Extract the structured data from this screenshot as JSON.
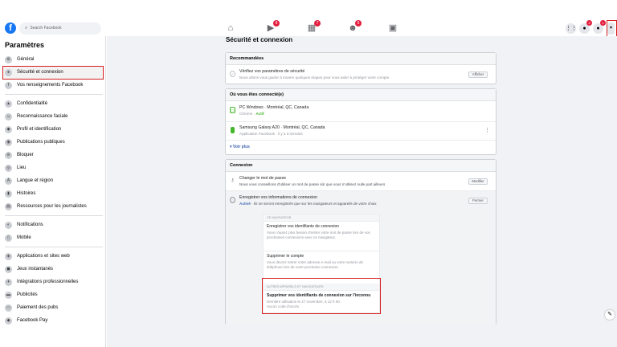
{
  "topbar": {
    "logo": "f",
    "search_placeholder": "Search Facebook",
    "nav": [
      {
        "name": "home",
        "glyph": "⌂",
        "badge": ""
      },
      {
        "name": "watch",
        "glyph": "▶",
        "badge": "9"
      },
      {
        "name": "marketplace",
        "glyph": "▦",
        "badge": "7"
      },
      {
        "name": "groups",
        "glyph": "☻",
        "badge": "5"
      },
      {
        "name": "gaming",
        "glyph": "▣",
        "badge": ""
      }
    ],
    "menu_glyph": "⋮⋮",
    "messenger_glyph": "●",
    "messenger_badge": "3",
    "notif_glyph": "●",
    "notif_badge": "1",
    "account_glyph": "▾"
  },
  "sidebar": {
    "title": "Paramètres",
    "items": [
      {
        "label": "Général",
        "icon": "gear-icon",
        "glyph": "⚙"
      },
      {
        "label": "Sécurité et connexion",
        "icon": "shield-icon",
        "glyph": "●"
      },
      {
        "label": "Vos renseignements Facebook",
        "icon": "facebook-icon",
        "glyph": "f"
      },
      {
        "label": "Confidentialité",
        "icon": "lock-icon",
        "glyph": "▲"
      },
      {
        "label": "Reconnaissance faciale",
        "icon": "face-icon",
        "glyph": "☺"
      },
      {
        "label": "Profil et identification",
        "icon": "tag-icon",
        "glyph": "◆"
      },
      {
        "label": "Publications publiques",
        "icon": "globe-icon",
        "glyph": "◉"
      },
      {
        "label": "Bloquer",
        "icon": "block-icon",
        "glyph": "⊘"
      },
      {
        "label": "Lieu",
        "icon": "location-icon",
        "glyph": "◎"
      },
      {
        "label": "Langue et région",
        "icon": "language-icon",
        "glyph": "A"
      },
      {
        "label": "Histoires",
        "icon": "book-icon",
        "glyph": "▮"
      },
      {
        "label": "Ressources pour les journalistes",
        "icon": "journalist-icon",
        "glyph": "▤"
      },
      {
        "label": "Notifications",
        "icon": "globe-bell-icon",
        "glyph": "◐"
      },
      {
        "label": "Mobile",
        "icon": "mobile-icon",
        "glyph": "▯"
      },
      {
        "label": "Applications et sites web",
        "icon": "apps-icon",
        "glyph": "◈"
      },
      {
        "label": "Jeux instantanés",
        "icon": "games-icon",
        "glyph": "◼"
      },
      {
        "label": "Intégrations professionnelles",
        "icon": "integrations-icon",
        "glyph": "✈"
      },
      {
        "label": "Publicités",
        "icon": "ads-icon",
        "glyph": "▬"
      },
      {
        "label": "Paiement des pubs",
        "icon": "payment-icon",
        "glyph": "▭"
      },
      {
        "label": "Facebook Pay",
        "icon": "pay-icon",
        "glyph": "◆"
      }
    ]
  },
  "main": {
    "title": "Sécurité et connexion",
    "recommended": {
      "header": "Recommandées",
      "title": "Vérifiez vos paramètres de sécurité",
      "desc": "Nous allons vous guider à travers quelques étapes pour vous aider à protéger votre compte",
      "button": "Afficher"
    },
    "where": {
      "header": "Où vous êtes connecté(e)",
      "sessions": [
        {
          "title": "PC Windows · Montréal, QC, Canada",
          "sub1": "Chrome · ",
          "sub2": "Actif"
        },
        {
          "title": "Samsung Galaxy A20 · Montréal, QC, Canada",
          "sub1": "Application Facebook · il y a 3 minutes",
          "sub2": ""
        }
      ],
      "more": "Voir plus"
    },
    "login": {
      "header": "Connexion",
      "password_title": "Changer le mot de passe",
      "password_desc": "Nous vous conseillons d'utiliser un mot de passe sûr que vous n'utilisez nulle part ailleurs",
      "password_button": "Modifier",
      "save_title": "Enregistrer vos informations de connexion",
      "save_status": "Activé",
      "save_desc": " · Ils ne seront enregistrés que sur les navigateurs et appareils de votre choix",
      "save_button": "Fermer",
      "panel": {
        "section1": "CE NAVIGATEUR",
        "opt1_title": "Enregistrer vos identifiants de connexion",
        "opt1_desc": "Vous n'aurez plus besoin d'entrer votre mot de passe lors de vos prochaines connexions avec ce navigateur.",
        "opt2_title": "Supprimer le compte",
        "opt2_desc": "Vous devrez entrer votre adresse e-mail ou votre numéro de téléphone lors de votre prochaine connexion.",
        "section2": "AUTRES APPAREILS ET NAVIGATEURS",
        "opt3_title": "Supprimer vos identifiants de connexion sur l'inconnu",
        "opt3_desc1": "Dernière utilisation le 27 novembre, à 12 h 00.",
        "opt3_desc2": "Aucun code d'accès"
      }
    }
  },
  "colors": {
    "brand": "#1877f2",
    "highlight": "#d81f1f",
    "active": "#42b72a"
  }
}
